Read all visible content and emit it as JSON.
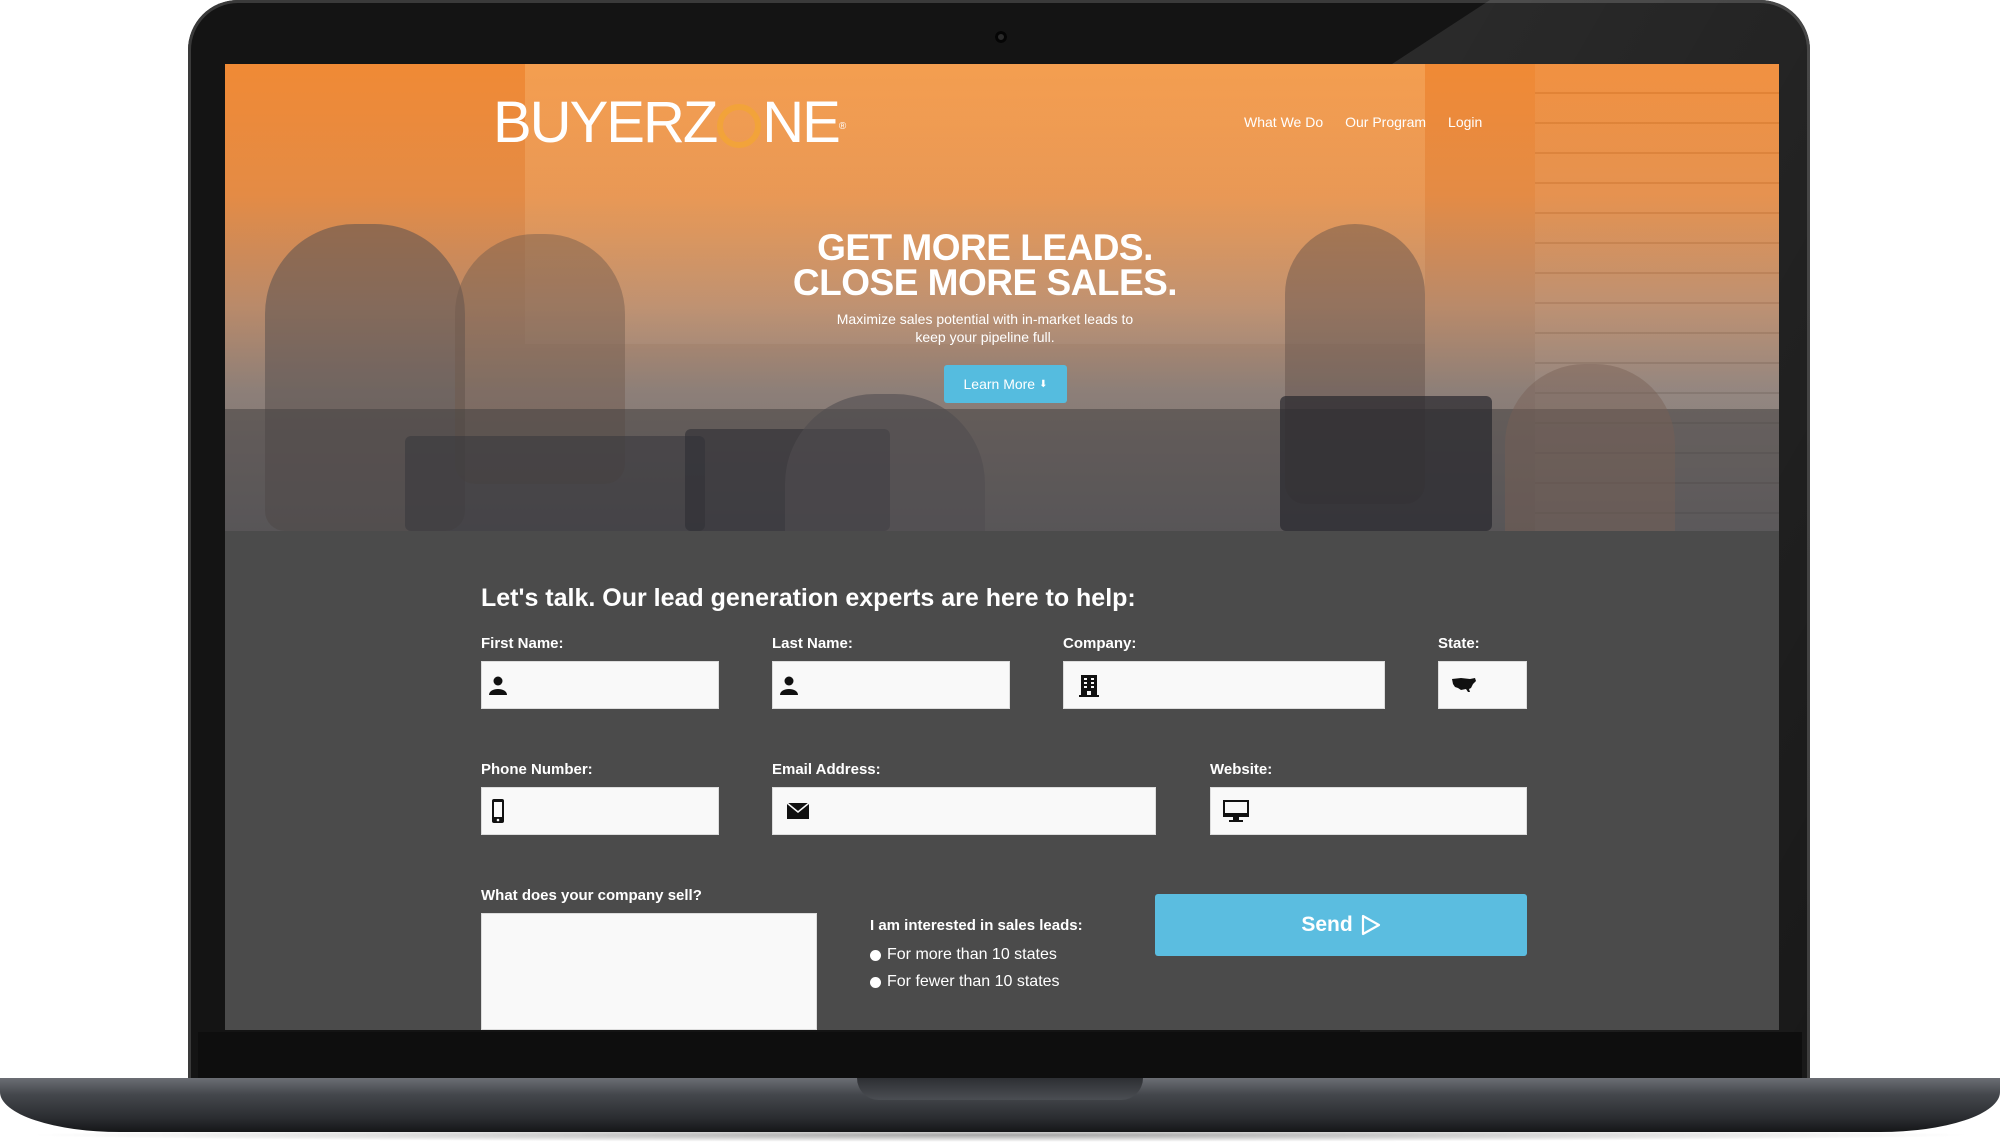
{
  "brand": {
    "logo_main": "BUYERZ",
    "logo_o": "O",
    "logo_end": "NE",
    "logo_reg": "®",
    "accent_color": "#f2a33a",
    "button_color": "#5bbde0",
    "form_bg": "#4b4b4b"
  },
  "nav": {
    "items": [
      "What We Do",
      "Our Program",
      "Login"
    ]
  },
  "hero": {
    "title_line1": "GET MORE LEADS.",
    "title_line2": "CLOSE MORE SALES.",
    "subtitle_line1": "Maximize sales potential with in-market leads to",
    "subtitle_line2": "keep your pipeline full.",
    "cta_label": "Learn More",
    "cta_icon": "arrow-down-icon"
  },
  "form": {
    "heading": "Let's talk. Our lead generation experts are here to help:",
    "fields": {
      "first_name": {
        "label": "First Name:",
        "value": "",
        "icon": "person-icon"
      },
      "last_name": {
        "label": "Last Name:",
        "value": "",
        "icon": "person-icon"
      },
      "company": {
        "label": "Company:",
        "value": "",
        "icon": "building-icon"
      },
      "state": {
        "label": "State:",
        "value": "",
        "icon": "usa-map-icon"
      },
      "phone": {
        "label": "Phone Number:",
        "value": "",
        "icon": "mobile-phone-icon"
      },
      "email": {
        "label": "Email Address:",
        "value": "",
        "icon": "envelope-icon"
      },
      "website": {
        "label": "Website:",
        "value": "",
        "icon": "monitor-icon"
      },
      "sells": {
        "label": "What does your company sell?",
        "value": ""
      }
    },
    "interest": {
      "title": "I am interested in sales leads:",
      "options": [
        "For more than 10 states",
        "For fewer than 10 states"
      ]
    },
    "send_label": "Send",
    "send_icon": "play-triangle-icon"
  }
}
